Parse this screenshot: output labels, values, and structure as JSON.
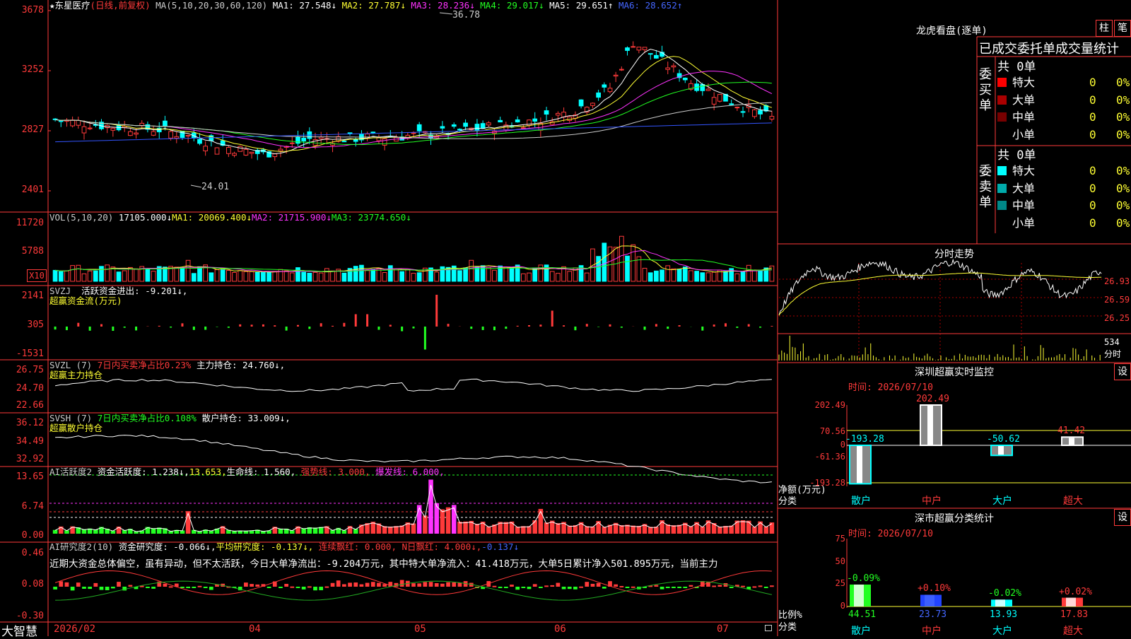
{
  "stock": {
    "name": "东星医疗",
    "mode": "(日线,前复权)"
  },
  "ma_header": {
    "label": "MA(5,10,20,30,60,120)",
    "items": [
      {
        "text": "MA1: 27.548↓",
        "color": "#ffffff"
      },
      {
        "text": "MA2: 27.787↓",
        "color": "#ffff33"
      },
      {
        "text": "MA3: 28.236↓",
        "color": "#ff33ff"
      },
      {
        "text": "MA4: 29.017↓",
        "color": "#22ff22"
      },
      {
        "text": "MA5: 29.651↑",
        "color": "#ffffff"
      },
      {
        "text": "MA6: 28.652↑",
        "color": "#4466ff"
      }
    ]
  },
  "price_axis": [
    "3678",
    "3252",
    "2827",
    "2401"
  ],
  "price_annotations": {
    "high": "36.78",
    "low": "24.01"
  },
  "vol": {
    "label": "VOL(5,10,20)",
    "value": "17105.000↓",
    "ma1": "MA1: 20069.400↓",
    "ma2": "MA2: 21715.900↓",
    "ma3": "MA3: 23774.650↓",
    "axis": [
      "11720",
      "5788"
    ],
    "unit": "X10"
  },
  "svzj": {
    "label": "SVZJ",
    "text": "活跃资金进出: -9.201↓,",
    "sub": "超赢资金流(万元)",
    "axis": [
      "2141",
      "305",
      "-1531"
    ]
  },
  "svzl": {
    "label": "SVZL (7)",
    "pct": "7日内买卖净占比0.23%",
    "text": "主力持仓: 24.760↓,",
    "sub": "超赢主力持仓",
    "axis": [
      "26.75",
      "24.70",
      "22.66"
    ]
  },
  "svsh": {
    "label": "SVSH (7)",
    "pct": "7日内买卖净占比0.108%",
    "text": "散户持仓: 33.009↓,",
    "sub": "超赢散户持仓",
    "axis": [
      "36.12",
      "34.49",
      "32.92"
    ]
  },
  "ai_active": {
    "label": "AI活跃度2",
    "t1": "资金活跃度: 1.238↓,",
    "t2": "13.653,",
    "t3": "生命线: 1.560,",
    "t4": "强势线: 3.000,",
    "t5": "爆发线: 6.000,",
    "axis": [
      "13.65",
      "6.74",
      "0.00"
    ]
  },
  "ai_research": {
    "label": "AI研究度2(10)",
    "t1": "资金研究度: -0.066↓,",
    "t2": "平均研究度: -0.137↓,",
    "t3": "连续飘红: 0.000,",
    "t4": "N日飘红: 4.000↓,",
    "t5": "-0.137↓",
    "axis": [
      "0.46",
      "0.08",
      "-0.30"
    ]
  },
  "commentary": "近期大资金总体偏空，虽有异动，但不太活跃，今日大单净流出：-9.204万元，其中特大单净流入：41.418万元，大单5日累计净入501.895万元，当前主力",
  "bottom": {
    "brand": "大智慧",
    "dates": [
      "2026/02",
      "04",
      "05",
      "06",
      "07"
    ]
  },
  "right": {
    "lhb_title": "龙虎看盘(逐单)",
    "btn1": "柱",
    "btn2": "笔",
    "table_title": "已成交委托单成交量统计",
    "buy_label": "委买单",
    "sell_label": "委卖单",
    "buy_total": "共 0单",
    "sell_total": "共 0单",
    "buy_rows": [
      {
        "name": "特大",
        "v": "0",
        "p": "0%",
        "color": "#ff0000"
      },
      {
        "name": "大单",
        "v": "0",
        "p": "0%",
        "color": "#aa0000"
      },
      {
        "name": "中单",
        "v": "0",
        "p": "0%",
        "color": "#770000"
      },
      {
        "name": "小单",
        "v": "0",
        "p": "0%",
        "color": ""
      }
    ],
    "sell_rows": [
      {
        "name": "特大",
        "v": "0",
        "p": "0%",
        "color": "#00ffff"
      },
      {
        "name": "大单",
        "v": "0",
        "p": "0%",
        "color": "#00aaaa"
      },
      {
        "name": "中单",
        "v": "0",
        "p": "0%",
        "color": "#008888"
      },
      {
        "name": "小单",
        "v": "0",
        "p": "0%",
        "color": ""
      }
    ],
    "intraday_title": "分时走势",
    "intraday_axis": [
      "26.93",
      "26.59",
      "26.25"
    ],
    "intraday_vol": "534",
    "intraday_unit": "分时",
    "monitor_title": "深圳超赢实时监控",
    "monitor_btn": "设",
    "monitor_time": "时间: 2026/07/10",
    "monitor_axis": [
      "202.49",
      "70.56",
      "0",
      "-61.36",
      "-193.28"
    ],
    "monitor_ylabel": "净额(万元)",
    "monitor_xlabel": "分类",
    "class_title": "深市超赢分类统计",
    "class_btn": "设",
    "class_time": "时间: 2026/07/10",
    "class_axis": [
      "75",
      "50",
      "25",
      "0"
    ],
    "class_ylabel": "比例%",
    "class_xlabel": "分类"
  },
  "chart_data": [
    {
      "type": "bar",
      "title": "深圳超赢实时监控",
      "categories": [
        "散户",
        "中户",
        "大户",
        "超大"
      ],
      "values": [
        -193.28,
        202.49,
        -50.62,
        41.42
      ],
      "ylabel": "净额(万元)",
      "xlabel": "分类",
      "ylim": [
        -193.28,
        202.49
      ]
    },
    {
      "type": "bar",
      "title": "深市超赢分类统计",
      "categories": [
        "散户",
        "中户",
        "大户",
        "超大"
      ],
      "values": [
        44.51,
        23.73,
        13.93,
        17.83
      ],
      "changes": [
        "-0.09%",
        "+0.10%",
        "-0.02%",
        "+0.02%"
      ],
      "ylabel": "比例%",
      "xlabel": "分类",
      "ylim": [
        0,
        75
      ]
    }
  ]
}
